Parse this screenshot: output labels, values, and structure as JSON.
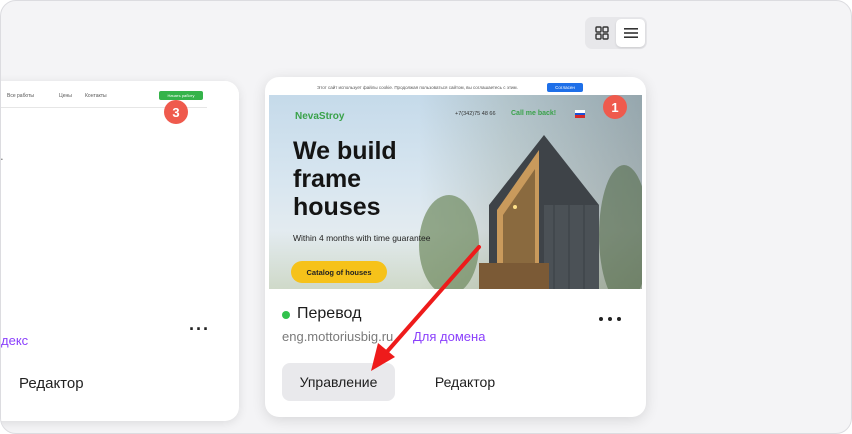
{
  "view_toggle": {
    "grid_icon": "grid-icon",
    "list_icon": "list-icon",
    "active": "list"
  },
  "left_card": {
    "nav_items": [
      "Все работы",
      "Цены",
      "Контакты"
    ],
    "nav_button": "Начать работу",
    "badge": "3",
    "link_partial": "декс",
    "editor_label": "Редактор"
  },
  "main_card": {
    "badge": "1",
    "preview": {
      "cookie_text": "Этот сайт использует файлы cookie. Продолжая пользоваться сайтом, вы соглашаетесь с этим.",
      "cookie_button": "Согласен",
      "logo": "NevaStroy",
      "phone": "+7(342)75 48 66",
      "call_button": "Call me back!",
      "headline": "We build frame houses",
      "subheadline": "Within 4 months with time guarantee",
      "cta": "Catalog of houses"
    },
    "status": "Перевод",
    "status_color": "#32c24d",
    "domain": "eng.mottoriusbig.ru",
    "domain_link": "Для домена",
    "manage_button": "Управление",
    "editor_button": "Редактор"
  },
  "colors": {
    "accent_link": "#8a3ffc",
    "badge": "#ef5a4d",
    "arrow": "#ee1b1b"
  }
}
